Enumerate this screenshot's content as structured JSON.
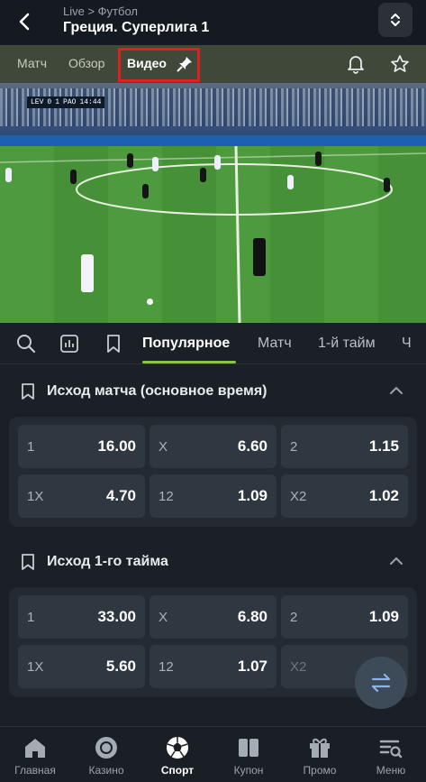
{
  "header": {
    "breadcrumb": "Live > Футбол",
    "title": "Греция. Суперлига 1"
  },
  "tabs": [
    {
      "label": "Матч"
    },
    {
      "label": "Обзор"
    },
    {
      "label": "Видео",
      "active": true
    }
  ],
  "video": {
    "scoreboard": {
      "home": "LEV",
      "home_score": "0",
      "away_score": "1",
      "away": "PAO",
      "time": "14:44"
    }
  },
  "market_tabs": [
    {
      "label": "Популярное",
      "active": true
    },
    {
      "label": "Матч"
    },
    {
      "label": "1-й тайм"
    },
    {
      "label": "Ч"
    }
  ],
  "sections": [
    {
      "title": "Исход матча (основное время)",
      "rows": [
        [
          {
            "label": "1",
            "odd": "16.00"
          },
          {
            "label": "X",
            "odd": "6.60"
          },
          {
            "label": "2",
            "odd": "1.15"
          }
        ],
        [
          {
            "label": "1X",
            "odd": "4.70"
          },
          {
            "label": "12",
            "odd": "1.09"
          },
          {
            "label": "X2",
            "odd": "1.02"
          }
        ]
      ]
    },
    {
      "title": "Исход 1-го тайма",
      "rows": [
        [
          {
            "label": "1",
            "odd": "33.00"
          },
          {
            "label": "X",
            "odd": "6.80"
          },
          {
            "label": "2",
            "odd": "1.09"
          }
        ],
        [
          {
            "label": "1X",
            "odd": "5.60"
          },
          {
            "label": "12",
            "odd": "1.07"
          },
          {
            "label": "X2",
            "odd": ""
          }
        ]
      ]
    }
  ],
  "bottom_nav": [
    {
      "label": "Главная",
      "icon": "home-icon"
    },
    {
      "label": "Казино",
      "icon": "casino-chip-icon"
    },
    {
      "label": "Спорт",
      "icon": "soccer-ball-icon",
      "active": true
    },
    {
      "label": "Купон",
      "icon": "coupon-icon"
    },
    {
      "label": "Промо",
      "icon": "gift-icon"
    },
    {
      "label": "Меню",
      "icon": "menu-search-icon"
    }
  ],
  "colors": {
    "accent_green": "#8bc34a",
    "highlight_red": "#e0201c",
    "tab_bar": "#3f4839"
  }
}
